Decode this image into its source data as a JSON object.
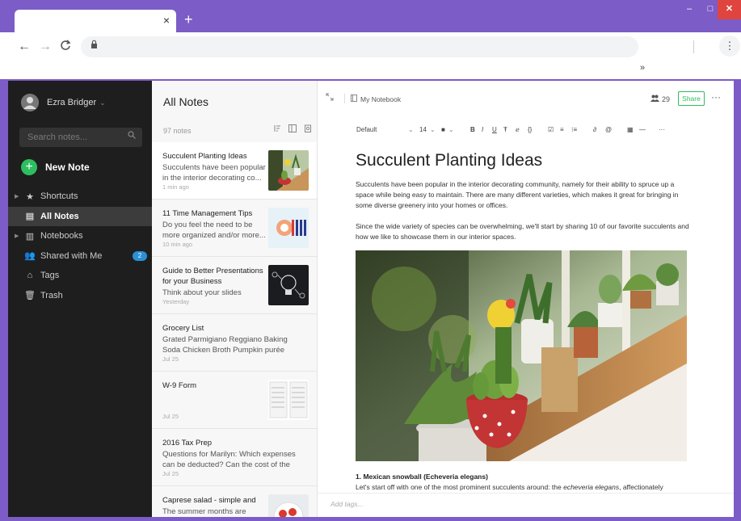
{
  "browser": {
    "new_tab_label": "+",
    "tab_close": "×",
    "window_controls": {
      "minimize": "–",
      "maximize": "□",
      "close": "✕"
    },
    "nav": {
      "back": "←",
      "forward": "→",
      "reload": "C"
    },
    "lock_icon": "lock-icon",
    "menu_glyph": "⋮",
    "bookmarks_overflow": "»"
  },
  "sidebar": {
    "user_name": "Ezra Bridger",
    "user_caret": "⌄",
    "search_placeholder": "Search notes...",
    "new_note_label": "New Note",
    "items": [
      {
        "label": "Shortcuts",
        "icon": "star-icon",
        "glyph": "★",
        "has_arrow": true,
        "active": false
      },
      {
        "label": "All Notes",
        "icon": "note-icon",
        "glyph": "▤",
        "has_arrow": false,
        "active": true
      },
      {
        "label": "Notebooks",
        "icon": "notebook-icon",
        "glyph": "▥",
        "has_arrow": true,
        "active": false
      },
      {
        "label": "Shared with Me",
        "icon": "people-icon",
        "glyph": "👥",
        "has_arrow": false,
        "active": false,
        "badge": "2"
      },
      {
        "label": "Tags",
        "icon": "tag-icon",
        "glyph": "⌂",
        "has_arrow": false,
        "active": false
      },
      {
        "label": "Trash",
        "icon": "trash-icon",
        "glyph": "🗑",
        "has_arrow": false,
        "active": false
      }
    ],
    "badge_color": "#2a8fd6",
    "accent": "#2dbe60"
  },
  "notelist": {
    "title": "All Notes",
    "count": "97 notes",
    "notes": [
      {
        "title": "Succulent Planting Ideas",
        "snippet": "Succulents have been popular in the interior decorating co...",
        "date": "1 min ago",
        "thumb": "plants",
        "selected": true
      },
      {
        "title": "11 Time Management Tips",
        "snippet": "Do you feel the need to be more organized and/or more...",
        "date": "10 min ago",
        "thumb": "hand"
      },
      {
        "title": "Guide to Better Presentations for your Business",
        "snippet": "Think about your slides when...",
        "date": "Yesterday",
        "thumb": "bulb"
      },
      {
        "title": "Grocery List",
        "snippet": "Grated Parmigiano Reggiano Baking Soda Chicken Broth Pumpkin purée Espresso Po...",
        "date": "Jul 25",
        "thumb": null
      },
      {
        "title": "W-9 Form",
        "snippet": "",
        "date": "Jul 25",
        "thumb": "form"
      },
      {
        "title": "2016 Tax Prep",
        "snippet": "Questions for Marilyn: Which expenses can be deducted? Can the cost of the NAO...",
        "date": "Jul 25",
        "thumb": null
      },
      {
        "title": "Caprese salad - simple and",
        "snippet": "The summer months are",
        "date": "",
        "thumb": "salad"
      }
    ]
  },
  "editor": {
    "notebook": "My Notebook",
    "share_count": "29",
    "share_label": "Share",
    "more": "···",
    "format": {
      "font": "Default",
      "size": "14",
      "bold": "B",
      "italic": "I",
      "underline": "U",
      "strike": "Ŧ",
      "more": "···"
    },
    "title": "Succulent Planting Ideas",
    "para1": "Succulents have been popular in the interior decorating community, namely for their ability to spruce up a space while being easy to maintain. There are many different varieties, which makes it great for bringing in some diverse greenery into your homes or offices.",
    "para2": "Since the wide variety of species can be overwhelming, we'll start by sharing 10 of our favorite succulents and how we like to showcase them in our interior spaces.",
    "heading1": "1. Mexican snowball (Echeveria elegans)",
    "para3_prefix": "Let's start off with one of the most prominent succulents around: the ",
    "para3_em": "echeveria elegans",
    "para3_suffix": ", affectionately",
    "tags_placeholder": "Add tags..."
  }
}
